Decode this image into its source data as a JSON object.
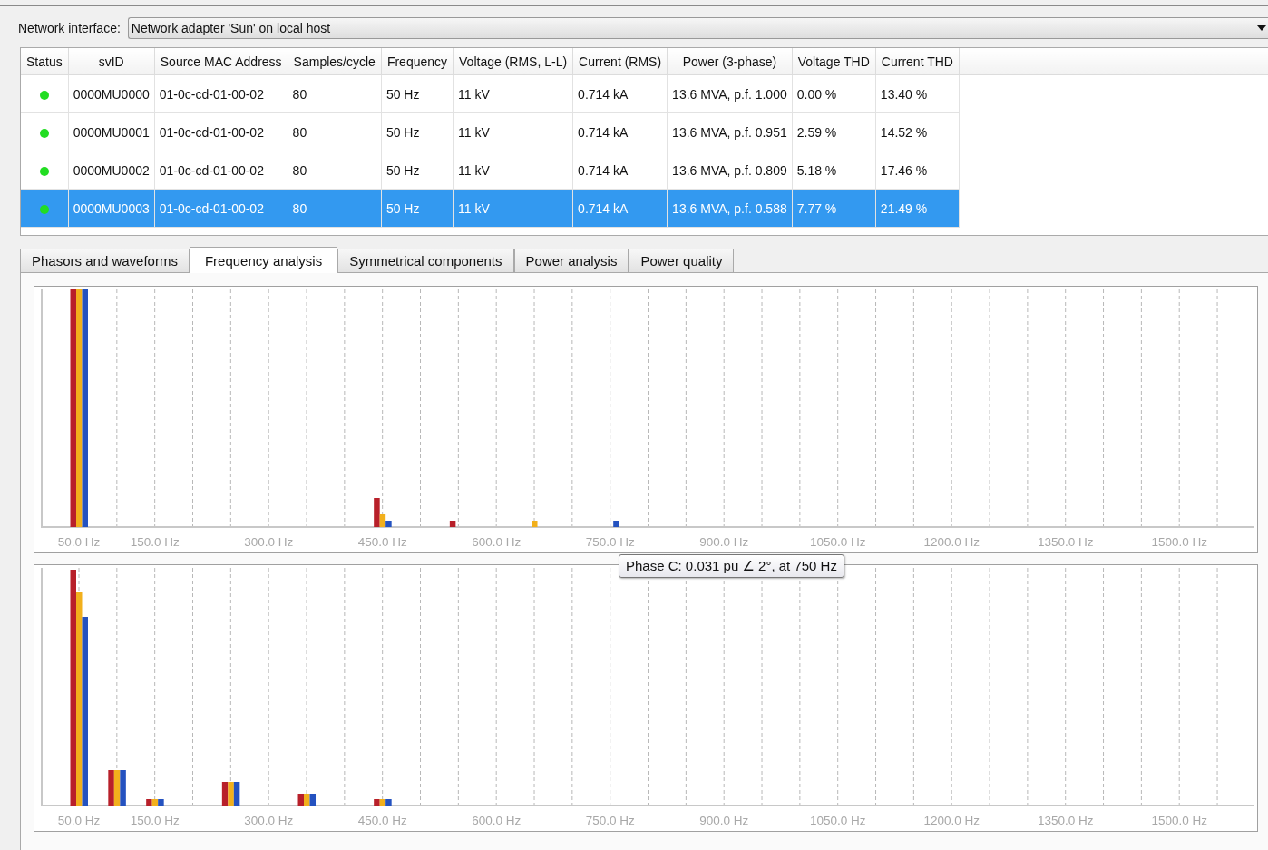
{
  "network_interface": {
    "label": "Network interface:",
    "value": "Network adapter 'Sun' on local host"
  },
  "table": {
    "status_column": "Status",
    "columns": [
      "svID",
      "Source MAC Address",
      "Samples/cycle",
      "Frequency",
      "Voltage (RMS, L-L)",
      "Current (RMS)",
      "Power (3-phase)",
      "Voltage THD",
      "Current THD"
    ],
    "rows": [
      {
        "color": "#22dd22",
        "selected": false,
        "cells": [
          "0000MU0000",
          "01-0c-cd-01-00-02",
          "80",
          "50 Hz",
          "11 kV",
          "0.714 kA",
          "13.6 MVA, p.f. 1.000",
          "0.00 %",
          "13.40 %"
        ]
      },
      {
        "color": "#22dd22",
        "selected": false,
        "cells": [
          "0000MU0001",
          "01-0c-cd-01-00-02",
          "80",
          "50 Hz",
          "11 kV",
          "0.714 kA",
          "13.6 MVA, p.f. 0.951",
          "2.59 %",
          "14.52 %"
        ]
      },
      {
        "color": "#22dd22",
        "selected": false,
        "cells": [
          "0000MU0002",
          "01-0c-cd-01-00-02",
          "80",
          "50 Hz",
          "11 kV",
          "0.714 kA",
          "13.6 MVA, p.f. 0.809",
          "5.18 %",
          "17.46 %"
        ]
      },
      {
        "color": "#22dd22",
        "selected": true,
        "cells": [
          "0000MU0003",
          "01-0c-cd-01-00-02",
          "80",
          "50 Hz",
          "11 kV",
          "0.714 kA",
          "13.6 MVA, p.f. 0.588",
          "7.77 %",
          "21.49 %"
        ]
      }
    ]
  },
  "tabs": [
    {
      "label": "Phasors and waveforms",
      "selected": false
    },
    {
      "label": "Frequency analysis",
      "selected": true
    },
    {
      "label": "Symmetrical components",
      "selected": false
    },
    {
      "label": "Power analysis",
      "selected": false
    },
    {
      "label": "Power quality",
      "selected": false
    }
  ],
  "charts": [
    {
      "x_labels": [
        "50.0 Hz",
        "150.0 Hz",
        "300.0 Hz",
        "450.0 Hz",
        "600.0 Hz",
        "750.0 Hz",
        "900.0 Hz",
        "1050.0 Hz",
        "1200.0 Hz",
        "1350.0 Hz",
        "1500.0 Hz"
      ]
    },
    {
      "x_labels": [
        "50.0 Hz",
        "150.0 Hz",
        "300.0 Hz",
        "450.0 Hz",
        "600.0 Hz",
        "750.0 Hz",
        "900.0 Hz",
        "1050.0 Hz",
        "1200.0 Hz",
        "1350.0 Hz",
        "1500.0 Hz"
      ]
    }
  ],
  "tooltip": {
    "text": "Phase C: 0.031 pu ∠ 2°, at 750 Hz"
  }
}
